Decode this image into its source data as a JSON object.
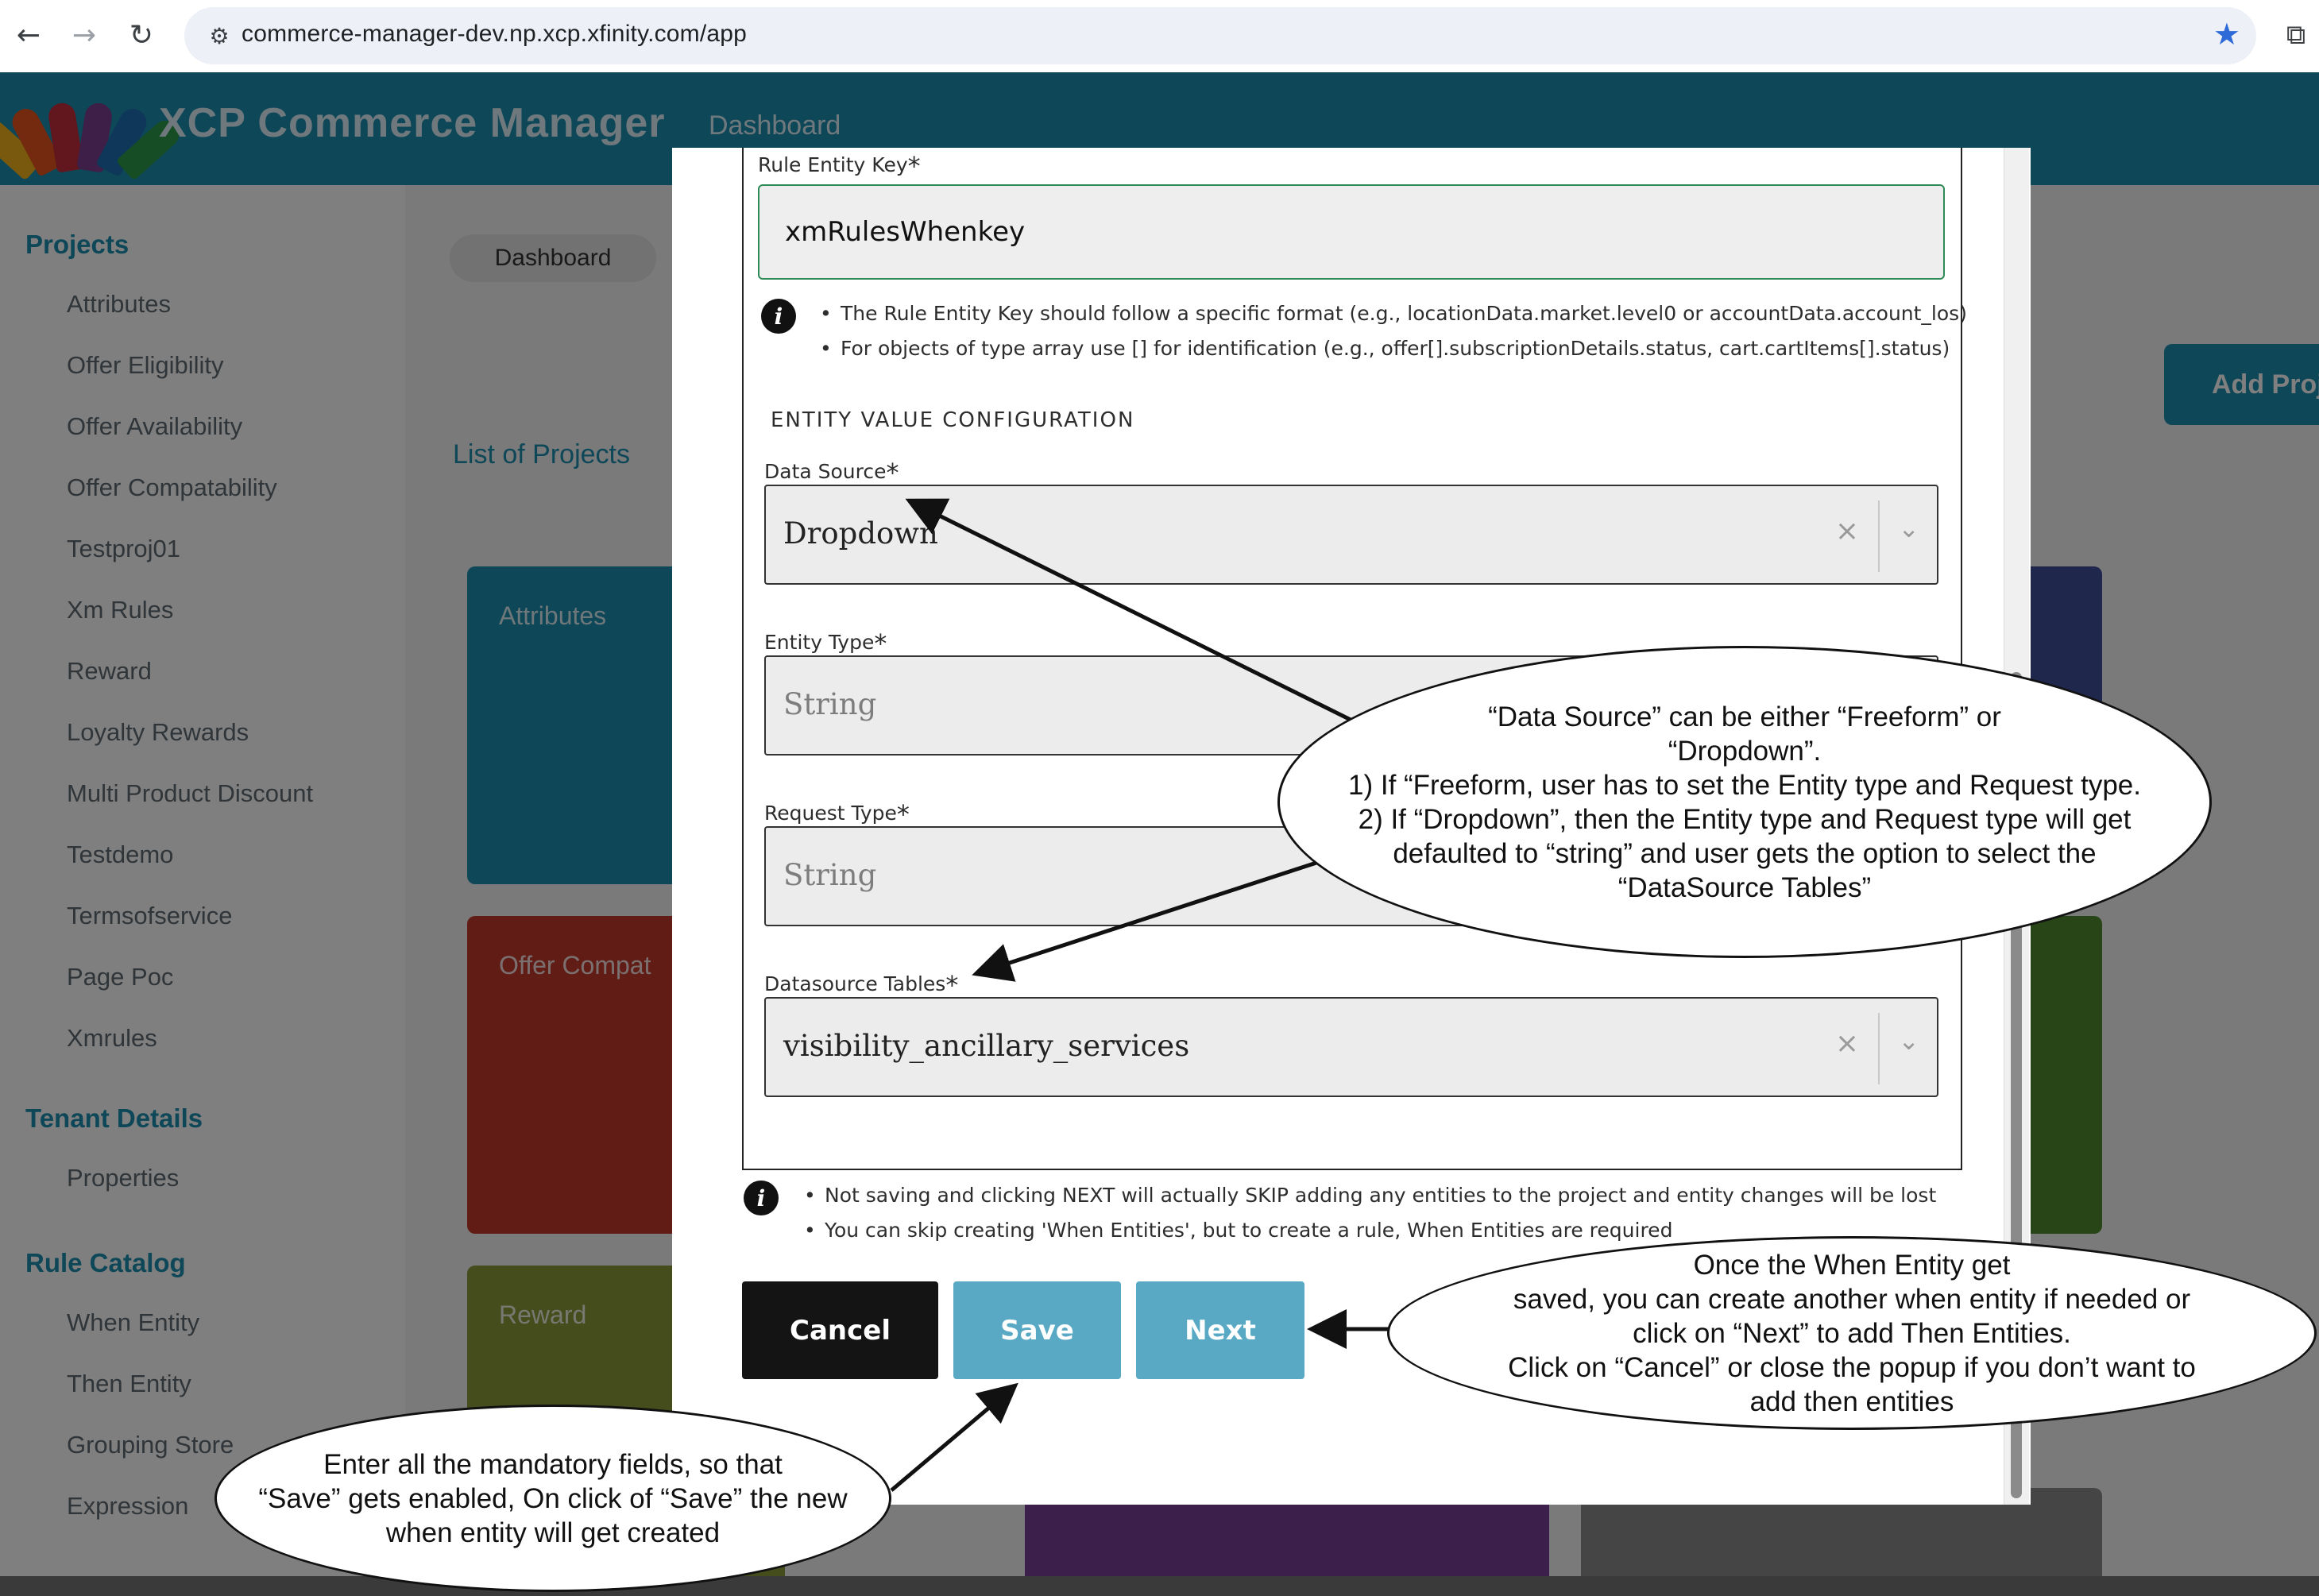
{
  "browser": {
    "url": "commerce-manager-dev.np.xcp.xfinity.com/app",
    "back_icon": "←",
    "forward_icon": "→",
    "reload_icon": "↻",
    "site_info_icon": "⚙",
    "star_icon": "★",
    "extensions_icon": "⧉"
  },
  "app": {
    "title": "XCP Commerce Manager",
    "nav_dashboard": "Dashboard",
    "breadcrumb": "Dashboard",
    "list_title": "List of Projects",
    "add_button": "Add Proj",
    "sidebar": {
      "projects_heading": "Projects",
      "project_items": [
        "Attributes",
        "Offer Eligibility",
        "Offer Availability",
        "Offer Compatability",
        "Testproj01",
        "Xm Rules",
        "Reward",
        "Loyalty Rewards",
        "Multi Product Discount",
        "Testdemo",
        "Termsofservice",
        "Page Poc",
        "Xmrules"
      ],
      "tenant_heading": "Tenant Details",
      "tenant_items": [
        "Properties"
      ],
      "catalog_heading": "Rule Catalog",
      "catalog_items": [
        "When Entity",
        "Then Entity",
        "Grouping Store",
        "Expression"
      ]
    },
    "cards": [
      "Attributes",
      "Offer Compat",
      "Reward"
    ]
  },
  "modal": {
    "rule_entity_key": {
      "label": "Rule Entity Key",
      "required_mark": "*",
      "value": "xmRulesWhenkey"
    },
    "key_hints": [
      "The Rule Entity Key should follow a specific format (e.g., locationData.market.level0 or accountData.account_los)",
      "For objects of type array use [] for identification (e.g., offer[].subscriptionDetails.status, cart.cartItems[].status)"
    ],
    "section_title": "ENTITY VALUE CONFIGURATION",
    "data_source": {
      "label": "Data Source",
      "required_mark": "*",
      "value": "Dropdown"
    },
    "entity_type": {
      "label": "Entity Type",
      "required_mark": "*",
      "value": "String"
    },
    "request_type": {
      "label": "Request Type",
      "required_mark": "*",
      "value": "String"
    },
    "datasource_tables": {
      "label": "Datasource Tables",
      "required_mark": "*",
      "value": "visibility_ancillary_services"
    },
    "clear_icon": "×",
    "chevron_icon": "⌄",
    "info_icon": "i",
    "footer_notes": [
      "Not saving and clicking NEXT will actually SKIP adding any entities to the project and entity changes will be lost",
      "You can skip creating 'When Entities', but to create a rule, When Entities are required"
    ],
    "buttons": {
      "cancel": "Cancel",
      "save": "Save",
      "next": "Next"
    }
  },
  "annotations": {
    "data_source_note": "“Data Source” can be either “Freeform” or\n“Dropdown”.\n1) If “Freeform, user has to set the Entity type and Request type.\n2) If “Dropdown”, then the Entity type and Request type will get\ndefaulted to “string” and user gets the option to select the\n“DataSource Tables”",
    "next_note": "Once the When Entity get\nsaved, you can create another when entity if needed or\nclick on “Next” to add Then Entities.\nClick on “Cancel” or close the popup if you don’t want to\nadd then entities",
    "save_note": "Enter all the mandatory fields, so that\n“Save” gets enabled, On click of “Save” the new\nwhen entity will get created"
  },
  "colors": {
    "brand": "#1a8eb0",
    "valid_border": "#2e8b57",
    "primary_button": "#5aa9c4",
    "cancel_button": "#141414"
  }
}
